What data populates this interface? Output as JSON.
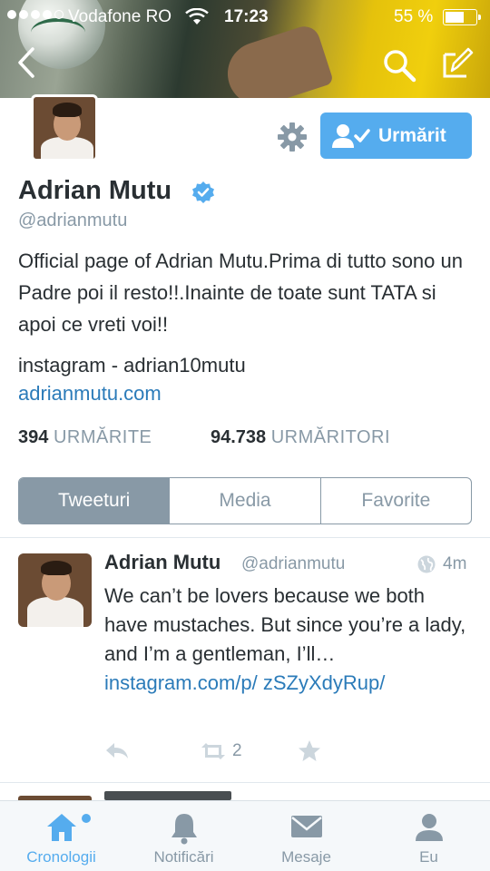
{
  "status_bar": {
    "carrier": "Vodafone RO",
    "time": "17:23",
    "battery": "55 %",
    "battery_level": 0.55,
    "signal_bars": 4
  },
  "nav": {
    "back_icon": "chevron-left-icon",
    "search_icon": "search-icon",
    "compose_icon": "compose-icon"
  },
  "profile": {
    "name": "Adrian Mutu",
    "handle": "@adrianmutu",
    "verified": true,
    "bio": "Official page of Adrian Mutu.Prima di tutto sono un Padre poi il resto!!.Inainte de toate sunt TATA si apoi ce vreti voi!!",
    "location": "instagram - adrian10mutu",
    "website": "adrianmutu.com",
    "follow_button": "Urmărit",
    "following_count": "394",
    "following_label": "URMĂRITE",
    "followers_count": "94.738",
    "followers_label": "URMĂRITORI"
  },
  "tabs": [
    "Tweeturi",
    "Media",
    "Favorite"
  ],
  "active_tab": 0,
  "tweet": {
    "name": "Adrian Mutu",
    "handle": "@adrianmutu",
    "time": "4m",
    "text": "We can’t be lovers because we both have mustaches. But since you’re a lady, and I’m a gentleman, I’ll…",
    "link": "instagram.com/p/ zSZyXdyRup/",
    "retweets": "2"
  },
  "tabbar": {
    "items": [
      "Cronologii",
      "Notificări",
      "Mesaje",
      "Eu"
    ],
    "active": 0
  },
  "colors": {
    "accent": "#55acee",
    "link": "#2b7bb9",
    "muted": "#8899a6",
    "text": "#292f33"
  }
}
